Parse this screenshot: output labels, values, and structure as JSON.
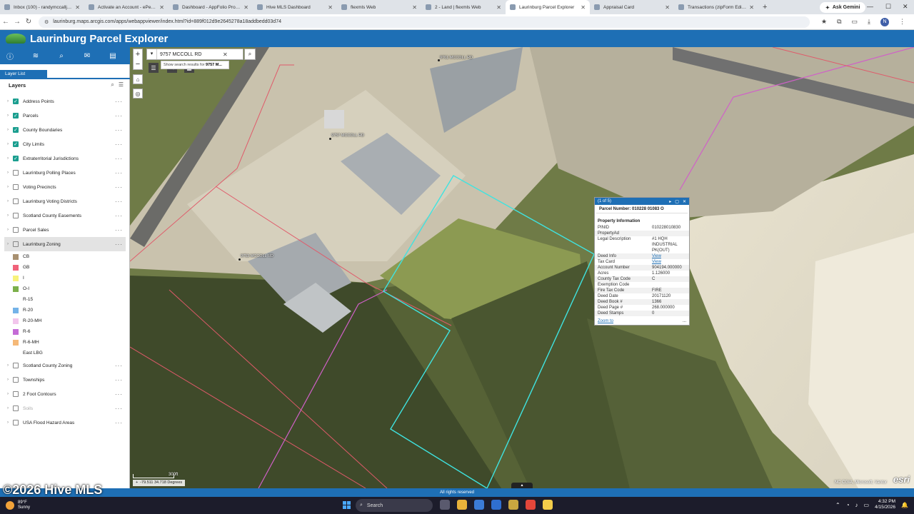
{
  "browser": {
    "tabs": [
      {
        "label": "Inbox (100) - randymccalljr@gm",
        "active": false
      },
      {
        "label": "Activate an Account - ePermits",
        "active": false
      },
      {
        "label": "Dashboard - AppFolio Property",
        "active": false
      },
      {
        "label": "Hive MLS Dashboard",
        "active": false
      },
      {
        "label": "flexmls Web",
        "active": false
      },
      {
        "label": "2 - Land | flexmls Web",
        "active": false
      },
      {
        "label": "Laurinburg Parcel Explorer",
        "active": true
      },
      {
        "label": "Appraisal Card",
        "active": false
      },
      {
        "label": "Transactions (zipForm Edition)",
        "active": false
      }
    ],
    "new_tab": "+",
    "ask_gemini": "Ask Gemini",
    "url": "laurinburg.maps.arcgis.com/apps/webappviewer/index.html?id=889f012d9e2645278a18addbedd03d74",
    "profile_initial": "N"
  },
  "app": {
    "title": "Laurinburg Parcel Explorer"
  },
  "panel": {
    "tab_label": "Layer List",
    "header": "Layers",
    "layers": [
      {
        "label": "Address Points",
        "checked": true
      },
      {
        "label": "Parcels",
        "checked": true
      },
      {
        "label": "County Boundaries",
        "checked": true
      },
      {
        "label": "City Limits",
        "checked": true
      },
      {
        "label": "Extraterritorial Jurisdictions",
        "checked": true
      },
      {
        "label": "Laurinburg Polling Places",
        "checked": false
      },
      {
        "label": "Voting Precincts",
        "checked": false
      },
      {
        "label": "Laurinburg Voting Districts",
        "checked": false
      },
      {
        "label": "Scotland County Easements",
        "checked": false
      },
      {
        "label": "Parcel Sales",
        "checked": false
      },
      {
        "label": "Laurinburg Zoning",
        "checked": false
      }
    ],
    "zoning_legend": [
      {
        "label": "CB",
        "color": "#a89070"
      },
      {
        "label": "GB",
        "color": "#f0627a"
      },
      {
        "label": "I",
        "color": "#f7f27a"
      },
      {
        "label": "O-I",
        "color": "#7cb04a"
      },
      {
        "label": "R-15",
        "color": "#ffffff"
      },
      {
        "label": "R-20",
        "color": "#74b3e8"
      },
      {
        "label": "R-20-MH",
        "color": "#f2c6ec"
      },
      {
        "label": "R-6",
        "color": "#c46bd6"
      },
      {
        "label": "R-6-MH",
        "color": "#f5b978"
      },
      {
        "label": "East LBG",
        "color": "#ffffff"
      }
    ],
    "layers_after": [
      {
        "label": "Scotland County Zoning",
        "checked": false,
        "dim": false
      },
      {
        "label": "Townships",
        "checked": false,
        "dim": false
      },
      {
        "label": "2 Foot Contours",
        "checked": false,
        "dim": false
      },
      {
        "label": "Soils",
        "checked": false,
        "dim": true
      },
      {
        "label": "USA Flood Hazard Areas",
        "checked": false,
        "dim": false
      }
    ]
  },
  "map": {
    "search_value": "9757 MCCOLL RD",
    "suggest_prefix": "Show search results for ",
    "suggest_bold": "9757 M...",
    "address_labels": [
      "9761 MCCOLL RD",
      "9757 MCCOLL RD",
      "9753 MCCOLL RD"
    ],
    "scale_text": "300ft",
    "coordinates": "-79.511 34.718 Degrees",
    "attribution": "NC CGIA, Microsoft, Vantor",
    "esri": "esri"
  },
  "popup": {
    "counter": "(1 of 5)",
    "title": "Parcel Number: 010228 01083 O",
    "section": "Property Information",
    "rows": [
      {
        "k": "PINID",
        "v": "010228010830",
        "link": false
      },
      {
        "k": "PropertyAd",
        "v": "",
        "link": false
      },
      {
        "k": "Legal Description",
        "v": "#1 HQH INDUSTRIAL PK(OUT)",
        "link": false
      },
      {
        "k": "Deed Info",
        "v": "View",
        "link": true
      },
      {
        "k": "Tax Card",
        "v": "View",
        "link": true
      },
      {
        "k": "Account Number",
        "v": "904194.000000",
        "link": false
      },
      {
        "k": "Acres",
        "v": "1.126000",
        "link": false
      },
      {
        "k": "County Tax Code",
        "v": "C",
        "link": false
      },
      {
        "k": "Exemption Code",
        "v": "",
        "link": false
      },
      {
        "k": "Fire Tax Code",
        "v": "FIRE",
        "link": false
      },
      {
        "k": "Deed Date",
        "v": "20171120",
        "link": false
      },
      {
        "k": "Deed Book #",
        "v": "1366",
        "link": false
      },
      {
        "k": "Deed Page #",
        "v": "268.000000",
        "link": false
      },
      {
        "k": "Deed Stamps",
        "v": "0",
        "link": false
      }
    ],
    "zoom_to": "Zoom to",
    "more": "..."
  },
  "footer": {
    "rights": "All rights reserved",
    "watermark": "©2026 Hive MLS"
  },
  "taskbar": {
    "temp": "89°F",
    "condition": "Sunny",
    "search": "Search",
    "time": "4:32 PM",
    "date": "4/15/2026"
  }
}
